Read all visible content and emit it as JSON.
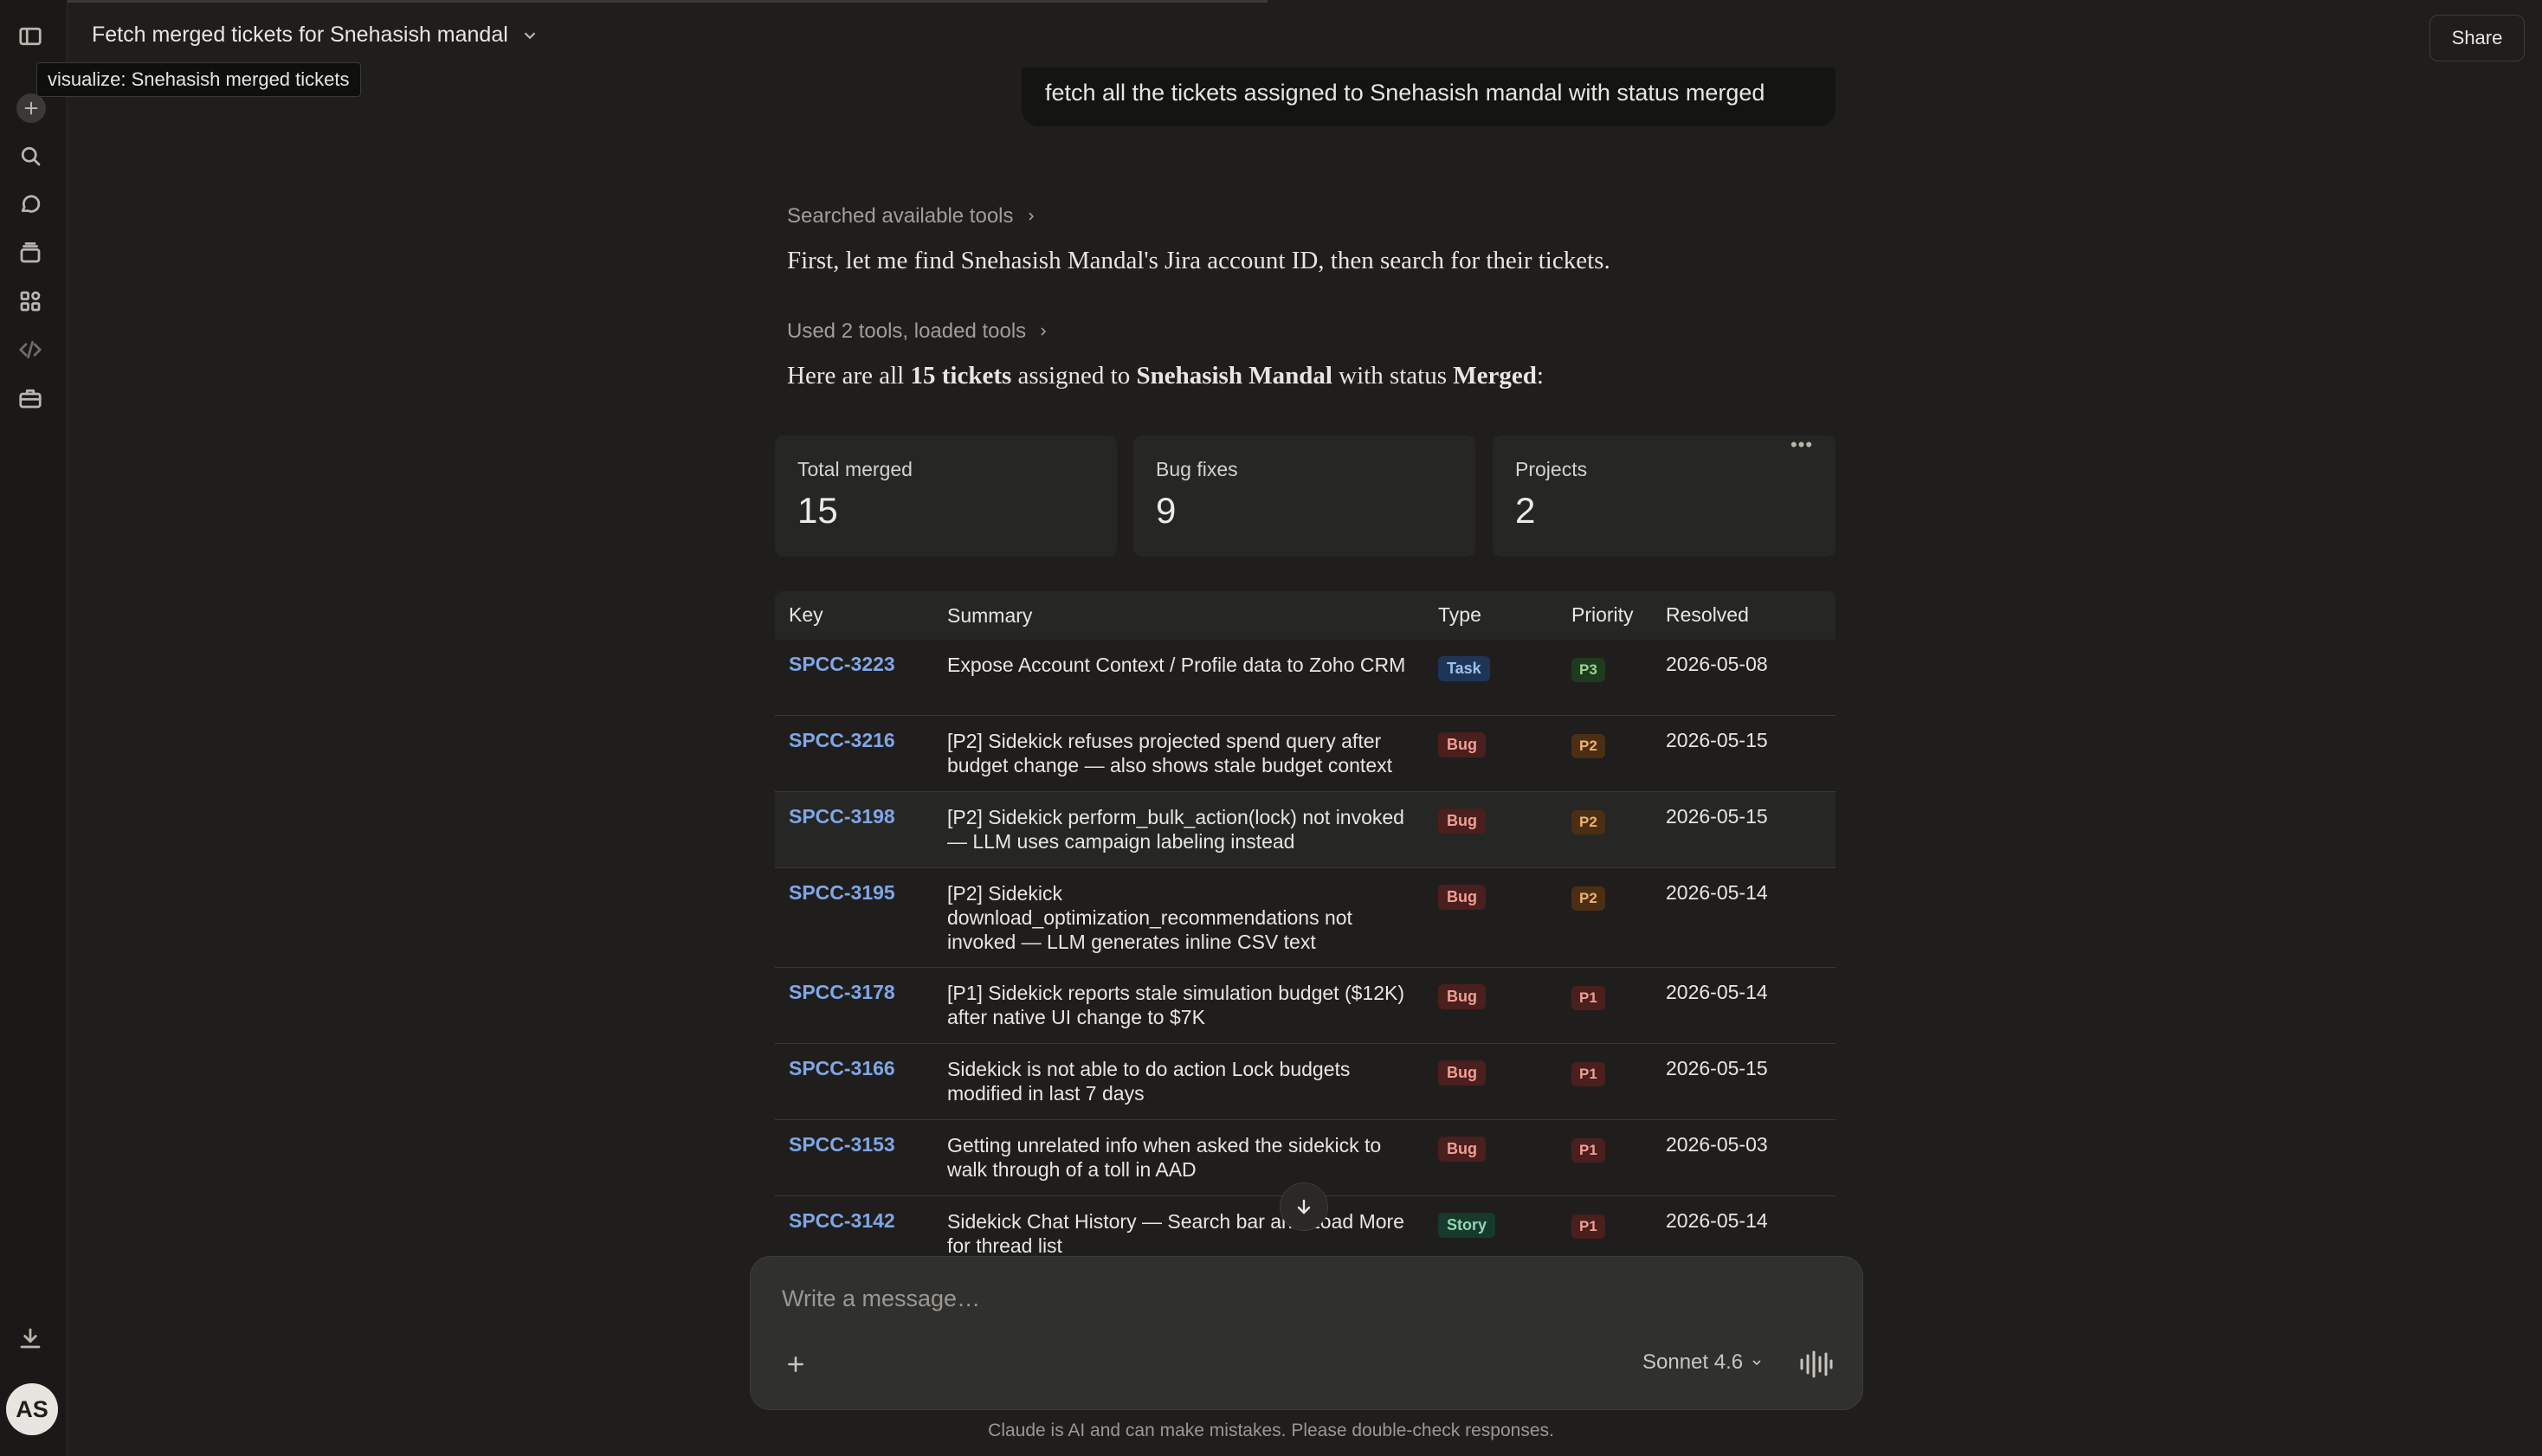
{
  "header": {
    "title": "Fetch merged tickets for Snehasish mandal",
    "share_label": "Share",
    "tooltip": "visualize: Snehasish merged tickets"
  },
  "sidebar": {
    "icons": [
      "sidebar-toggle-icon",
      "new-chat-icon",
      "search-icon",
      "chats-icon",
      "projects-icon",
      "artifacts-icon",
      "code-icon",
      "toolbox-icon",
      "download-icon"
    ],
    "avatar_initials": "AS"
  },
  "conversation": {
    "user_message": "fetch all the tickets assigned to Snehasish mandal with status merged",
    "tool_search_label": "Searched available tools",
    "intro_text": "First, let me find Snehasish Mandal's Jira account ID, then search for their tickets.",
    "tools_used_label": "Used 2 tools, loaded tools",
    "result": {
      "prefix": "Here are all ",
      "count_label": "15 tickets",
      "middle": " assigned to ",
      "assignee": "Snehasish Mandal",
      "status_prefix": " with status ",
      "status": "Merged",
      "suffix": ":"
    }
  },
  "stats": [
    {
      "label": "Total merged",
      "value": "15"
    },
    {
      "label": "Bug fixes",
      "value": "9"
    },
    {
      "label": "Projects",
      "value": "2"
    }
  ],
  "stats_menu_label": "•••",
  "table": {
    "headers": {
      "key": "Key",
      "summary": "Summary",
      "type": "Type",
      "priority": "Priority",
      "resolved": "Resolved"
    },
    "rows": [
      {
        "key": "SPCC-3223",
        "summary": "Expose Account Context / Profile data to Zoho CRM",
        "type": "Task",
        "priority": "P3",
        "resolved": "2026-05-08"
      },
      {
        "key": "SPCC-3216",
        "summary": "[P2] Sidekick refuses projected spend query after budget change — also shows stale budget context",
        "type": "Bug",
        "priority": "P2",
        "resolved": "2026-05-15"
      },
      {
        "key": "SPCC-3198",
        "summary": "[P2] Sidekick perform_bulk_action(lock) not invoked — LLM uses campaign labeling instead",
        "type": "Bug",
        "priority": "P2",
        "resolved": "2026-05-15"
      },
      {
        "key": "SPCC-3195",
        "summary": "[P2] Sidekick download_optimization_recommendations not invoked — LLM generates inline CSV text",
        "type": "Bug",
        "priority": "P2",
        "resolved": "2026-05-14"
      },
      {
        "key": "SPCC-3178",
        "summary": "[P1] Sidekick reports stale simulation budget ($12K) after native UI change to $7K",
        "type": "Bug",
        "priority": "P1",
        "resolved": "2026-05-14"
      },
      {
        "key": "SPCC-3166",
        "summary": "Sidekick is not able to do action Lock budgets modified in last 7 days",
        "type": "Bug",
        "priority": "P1",
        "resolved": "2026-05-15"
      },
      {
        "key": "SPCC-3153",
        "summary": "Getting unrelated info when asked the sidekick to walk through of a toll in AAD",
        "type": "Bug",
        "priority": "P1",
        "resolved": "2026-05-03"
      },
      {
        "key": "SPCC-3142",
        "summary": "Sidekick Chat History — Search bar and Load More for thread list",
        "type": "Story",
        "priority": "P1",
        "resolved": "2026-05-14"
      }
    ]
  },
  "composer": {
    "placeholder": "Write a message…",
    "model_label": "Sonnet 4.6"
  },
  "disclaimer": "Claude is AI and can make mistakes. Please double-check responses."
}
